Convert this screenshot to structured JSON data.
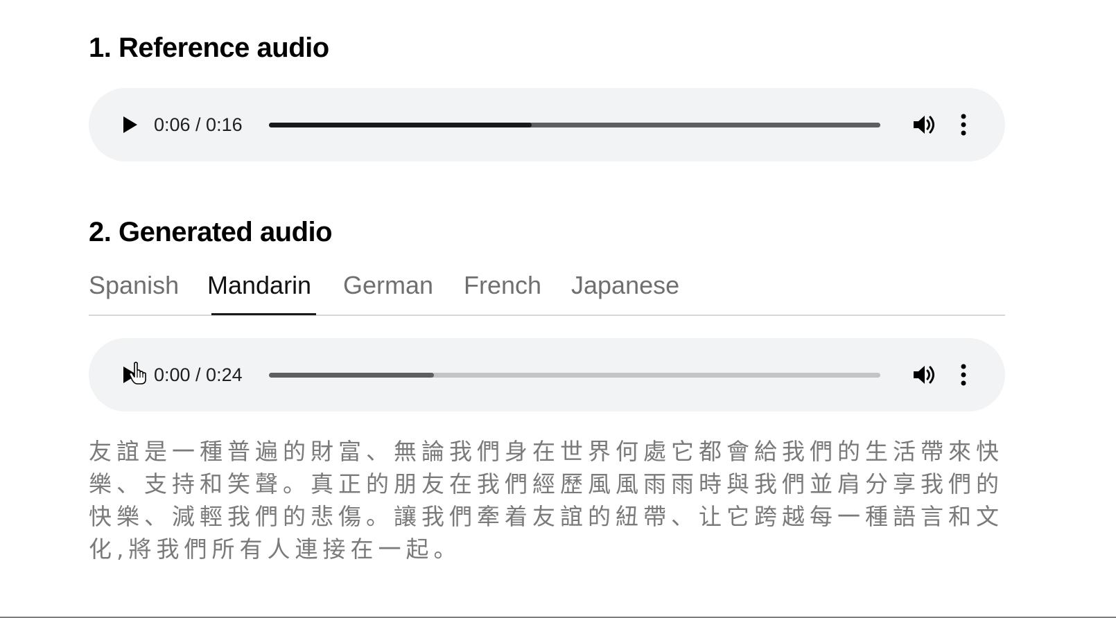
{
  "reference_section": {
    "heading": "1. Reference audio",
    "player": {
      "time": "0:06 / 0:16",
      "progress_fraction": 0.43,
      "buffered_fraction": 1.0
    }
  },
  "generated_section": {
    "heading": "2. Generated audio",
    "tabs": [
      {
        "label": "Spanish",
        "active": false
      },
      {
        "label": "Mandarin",
        "active": true
      },
      {
        "label": "German",
        "active": false
      },
      {
        "label": "French",
        "active": false
      },
      {
        "label": "Japanese",
        "active": false
      }
    ],
    "player": {
      "time": "0:00 / 0:24",
      "progress_fraction": 0.0,
      "buffered_fraction": 0.27
    },
    "transcript": "友誼是一種普遍的財富、無論我們身在世界何處它都會給我們的生活帶來快樂、支持和笑聲。真正的朋友在我們經歷風風雨雨時與我們並肩分享我們的快樂、減輕我們的悲傷。讓我們牽着友誼的紐帶、让它跨越每一種語言和文化,將我們所有人連接在一起。"
  },
  "colors": {
    "player_background": "#f1f3f4",
    "track_played": "#1a1a1a",
    "track_buffered": "#5f5f5f",
    "track_empty": "#c4c4c4",
    "tab_inactive": "#6f6f6f",
    "transcript_text": "#7a7a7a"
  },
  "icons": {
    "play": "play-icon",
    "volume": "volume-icon",
    "more": "more-vertical-icon",
    "cursor": "hand-pointer-icon"
  }
}
